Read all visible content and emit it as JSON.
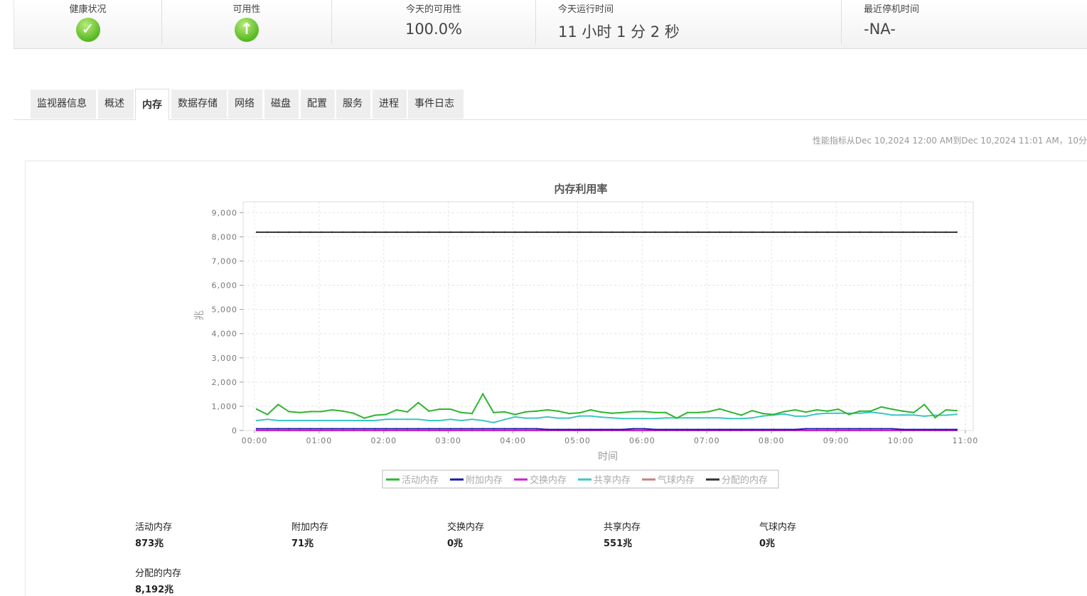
{
  "status": {
    "health": {
      "label": "健康状况",
      "icon": "check-icon"
    },
    "availability": {
      "label": "可用性",
      "icon": "arrow-up-icon"
    },
    "today_availability": {
      "label": "今天的可用性",
      "value": "100.0%"
    },
    "today_uptime": {
      "label": "今天运行时间",
      "value": "11 小时 1 分 2 秒"
    },
    "last_downtime": {
      "label": "最近停机时间",
      "value": "-NA-"
    }
  },
  "tabs": [
    "监视器信息",
    "概述",
    "内存",
    "数据存储",
    "网络",
    "磁盘",
    "配置",
    "服务",
    "进程",
    "事件日志"
  ],
  "active_tab": "内存",
  "range_text": "性能指标从Dec 10,2024 12:00 AM到Dec 10,2024 11:01 AM，10分",
  "chart_data": {
    "type": "line",
    "title": "内存利用率",
    "xlabel": "时间",
    "ylabel": "兆",
    "ylim": [
      0,
      9450
    ],
    "yticks": [
      "0",
      "1,000",
      "2,000",
      "3,000",
      "4,000",
      "5,000",
      "6,000",
      "7,000",
      "8,000",
      "9,000"
    ],
    "xticks": [
      "00:00",
      "01:00",
      "02:00",
      "03:00",
      "04:00",
      "05:00",
      "06:00",
      "07:00",
      "08:00",
      "09:00",
      "10:00",
      "11:00"
    ],
    "x_interval_minutes": 10,
    "grid": true,
    "legend_placement": "bottom",
    "series": [
      {
        "name": "活动内存",
        "color": "#2fb52f",
        "values": [
          880,
          660,
          1070,
          780,
          740,
          780,
          780,
          850,
          800,
          710,
          510,
          630,
          660,
          850,
          770,
          1150,
          800,
          880,
          880,
          740,
          700,
          1510,
          740,
          770,
          660,
          770,
          800,
          850,
          800,
          700,
          730,
          850,
          760,
          710,
          740,
          780,
          780,
          740,
          740,
          510,
          740,
          740,
          780,
          890,
          760,
          630,
          820,
          700,
          660,
          780,
          850,
          760,
          850,
          800,
          880,
          660,
          800,
          800,
          970,
          880,
          800,
          740,
          1070,
          530,
          850,
          820
        ]
      },
      {
        "name": "附加内存",
        "color": "#1a1aa8",
        "values": [
          71,
          71,
          71,
          71,
          71,
          71,
          71,
          71,
          71,
          71,
          71,
          71,
          71,
          71,
          71,
          71,
          71,
          71,
          71,
          71,
          71,
          71,
          71,
          71,
          71,
          71,
          71,
          40,
          40,
          40,
          40,
          40,
          40,
          40,
          40,
          71,
          71,
          40,
          40,
          40,
          40,
          40,
          40,
          40,
          40,
          40,
          40,
          40,
          40,
          40,
          40,
          71,
          71,
          71,
          71,
          71,
          71,
          71,
          71,
          71,
          40,
          40,
          40,
          40,
          40,
          40
        ]
      },
      {
        "name": "交换内存",
        "color": "#cc22cc",
        "values": [
          0,
          0,
          0,
          0,
          0,
          0,
          0,
          0,
          0,
          0,
          0,
          0,
          0,
          0,
          0,
          0,
          0,
          0,
          0,
          0,
          0,
          0,
          0,
          0,
          0,
          0,
          0,
          0,
          0,
          0,
          0,
          0,
          0,
          0,
          0,
          0,
          0,
          0,
          0,
          0,
          0,
          0,
          0,
          0,
          0,
          0,
          0,
          0,
          0,
          0,
          0,
          0,
          0,
          0,
          0,
          0,
          0,
          0,
          0,
          0,
          0,
          0,
          0,
          0,
          0,
          0
        ]
      },
      {
        "name": "共享内存",
        "color": "#3cc6c6",
        "values": [
          410,
          460,
          410,
          410,
          410,
          410,
          410,
          410,
          410,
          410,
          410,
          410,
          460,
          460,
          460,
          460,
          410,
          410,
          460,
          410,
          460,
          410,
          330,
          450,
          560,
          510,
          510,
          560,
          510,
          510,
          600,
          600,
          550,
          520,
          490,
          490,
          490,
          490,
          520,
          520,
          520,
          520,
          520,
          520,
          490,
          490,
          520,
          600,
          640,
          680,
          590,
          590,
          680,
          710,
          710,
          710,
          710,
          750,
          710,
          640,
          640,
          640,
          590,
          630,
          630,
          670
        ]
      },
      {
        "name": "气球内存",
        "color": "#c87f7f",
        "values": [
          0,
          0,
          0,
          0,
          0,
          0,
          0,
          0,
          0,
          0,
          0,
          0,
          0,
          0,
          0,
          0,
          0,
          0,
          0,
          0,
          0,
          0,
          0,
          0,
          0,
          0,
          0,
          0,
          0,
          0,
          0,
          0,
          0,
          0,
          0,
          0,
          0,
          0,
          0,
          0,
          0,
          0,
          0,
          0,
          0,
          0,
          0,
          0,
          0,
          0,
          0,
          0,
          0,
          0,
          0,
          0,
          0,
          0,
          0,
          0,
          0,
          0,
          0,
          0,
          0,
          0
        ]
      },
      {
        "name": "分配的内存",
        "color": "#333333",
        "values": [
          8192,
          8192,
          8192,
          8192,
          8192,
          8192,
          8192,
          8192,
          8192,
          8192,
          8192,
          8192,
          8192,
          8192,
          8192,
          8192,
          8192,
          8192,
          8192,
          8192,
          8192,
          8192,
          8192,
          8192,
          8192,
          8192,
          8192,
          8192,
          8192,
          8192,
          8192,
          8192,
          8192,
          8192,
          8192,
          8192,
          8192,
          8192,
          8192,
          8192,
          8192,
          8192,
          8192,
          8192,
          8192,
          8192,
          8192,
          8192,
          8192,
          8192,
          8192,
          8192,
          8192,
          8192,
          8192,
          8192,
          8192,
          8192,
          8192,
          8192,
          8192,
          8192,
          8192,
          8192,
          8192,
          8192
        ]
      }
    ]
  },
  "summary": [
    {
      "label": "活动内存",
      "value": "873兆"
    },
    {
      "label": "附加内存",
      "value": "71兆"
    },
    {
      "label": "交换内存",
      "value": "0兆"
    },
    {
      "label": "共享内存",
      "value": "551兆"
    },
    {
      "label": "气球内存",
      "value": "0兆"
    },
    {
      "label": "分配的内存",
      "value": "8,192兆"
    }
  ]
}
